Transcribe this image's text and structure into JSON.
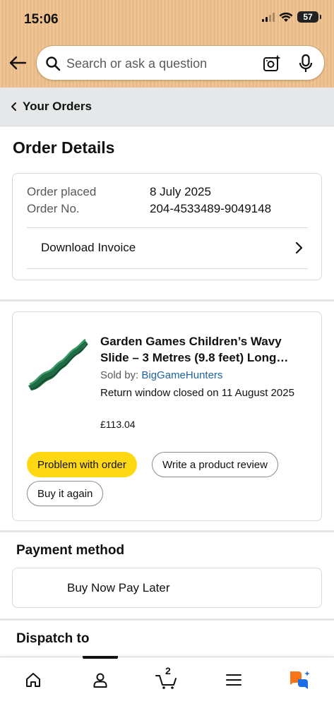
{
  "status_bar": {
    "time": "15:06",
    "battery": "57"
  },
  "search": {
    "placeholder": "Search or ask a question"
  },
  "breadcrumb": {
    "label": "Your Orders"
  },
  "page_title": "Order Details",
  "order_info": {
    "placed_label": "Order placed",
    "placed_value": "8 July 2025",
    "number_label": "Order No.",
    "number_value": "204-4533489-9049148",
    "invoice_label": "Download Invoice"
  },
  "item": {
    "title": "Garden Games Children’s Wavy Slide – 3 Metres (9.8 feet) Long…",
    "sold_by_label": "Sold by:",
    "seller": "BigGameHunters",
    "return_note": "Return window closed on 11 August 2025",
    "price": "£113.04",
    "buttons": {
      "problem": "Problem with order",
      "review": "Write a product review",
      "buy_again": "Buy it again"
    }
  },
  "payment": {
    "heading": "Payment method",
    "method": "Buy Now Pay Later"
  },
  "dispatch": {
    "heading": "Dispatch to"
  },
  "nav": {
    "cart_count": "2"
  },
  "colors": {
    "header_bg": "#edbf8c",
    "primary_button": "#ffd814",
    "link": "#2162a1",
    "rufus_orange": "#f7751a",
    "rufus_blue": "#1b6ee8"
  }
}
